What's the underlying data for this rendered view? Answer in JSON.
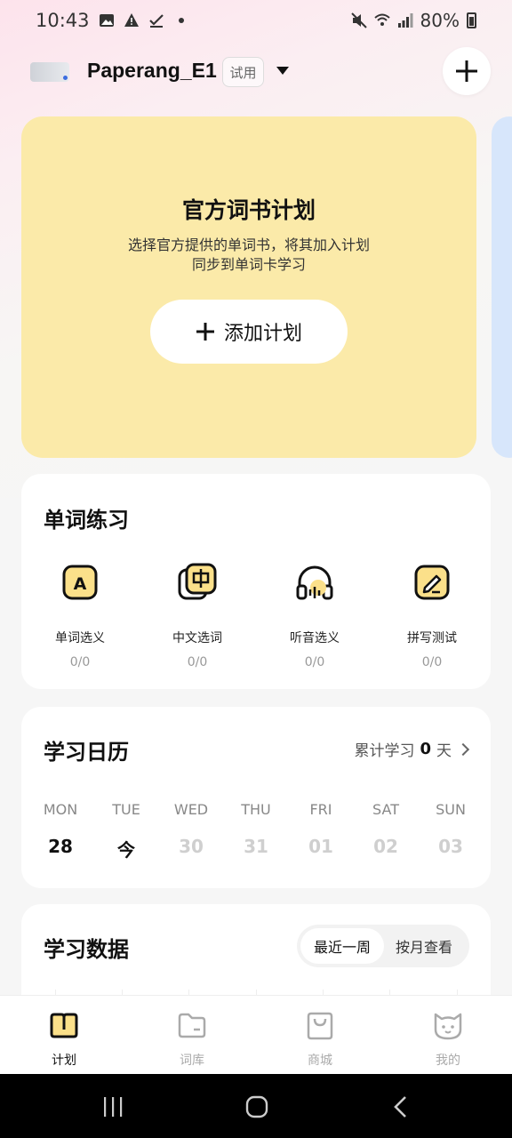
{
  "status_bar": {
    "time": "10:43",
    "battery": "80%"
  },
  "header": {
    "device_name": "Paperang_E1",
    "trial_badge": "试用"
  },
  "plan_card": {
    "title": "官方词书计划",
    "desc_line1": "选择官方提供的单词书，将其加入计划",
    "desc_line2": "同步到单词卡学习",
    "add_button": "添加计划",
    "bg_color": "#fbeaa9"
  },
  "practice": {
    "title": "单词练习",
    "items": [
      {
        "label": "单词选义",
        "count": "0/0",
        "icon": "letter-a-icon"
      },
      {
        "label": "中文选词",
        "count": "0/0",
        "icon": "chinese-char-icon"
      },
      {
        "label": "听音选义",
        "count": "0/0",
        "icon": "headphones-icon"
      },
      {
        "label": "拼写测试",
        "count": "0/0",
        "icon": "pencil-icon"
      }
    ]
  },
  "calendar": {
    "title": "学习日历",
    "summary_prefix": "累计学习",
    "summary_days": "0",
    "summary_suffix": "天",
    "days": [
      {
        "name": "MON",
        "num": "28",
        "active": true
      },
      {
        "name": "TUE",
        "num": "今",
        "active": true
      },
      {
        "name": "WED",
        "num": "30",
        "active": false
      },
      {
        "name": "THU",
        "num": "31",
        "active": false
      },
      {
        "name": "FRI",
        "num": "01",
        "active": false
      },
      {
        "name": "SAT",
        "num": "02",
        "active": false
      },
      {
        "name": "SUN",
        "num": "03",
        "active": false
      }
    ]
  },
  "data_section": {
    "title": "学习数据",
    "toggle_week": "最近一周",
    "toggle_month": "按月查看"
  },
  "bottom_nav": {
    "items": [
      {
        "label": "计划",
        "icon": "book-icon",
        "active": true
      },
      {
        "label": "词库",
        "icon": "folder-icon",
        "active": false
      },
      {
        "label": "商城",
        "icon": "shopping-bag-icon",
        "active": false
      },
      {
        "label": "我的",
        "icon": "cat-icon",
        "active": false
      }
    ]
  },
  "colors": {
    "accent_yellow": "#fbe08a",
    "plan_card": "#fbeaa9",
    "inactive_text": "#cfcfcf"
  }
}
